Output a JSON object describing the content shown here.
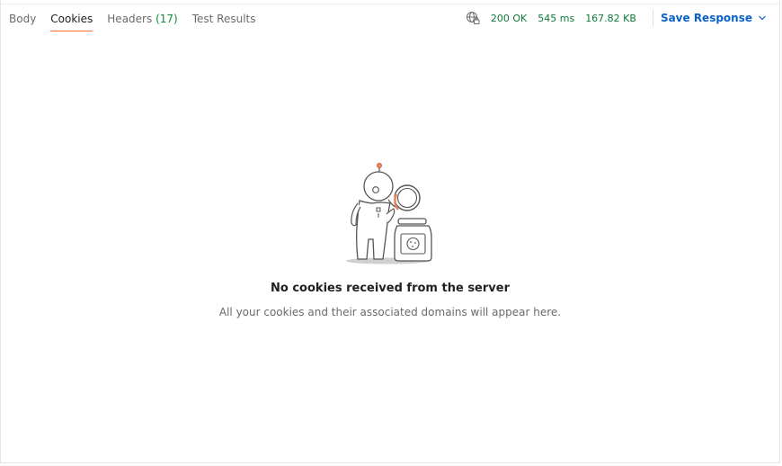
{
  "tabs": [
    {
      "label": "Body"
    },
    {
      "label": "Cookies",
      "active": true
    },
    {
      "label": "Headers",
      "count": "(17)"
    },
    {
      "label": "Test Results"
    }
  ],
  "status": {
    "network_icon": "globe-lock-icon",
    "code": "200 OK",
    "time": "545 ms",
    "size": "167.82 KB",
    "save_label": "Save Response",
    "save_chevron": "chevron-down-icon"
  },
  "colors": {
    "accent": "#ff6c37",
    "status_green": "#0f7a36",
    "link_blue": "#0b63c5"
  },
  "empty_state": {
    "illustration": "astronaut-cookie-jar-illustration",
    "title": "No cookies received from the server",
    "subtitle": "All your cookies and their associated domains will appear here."
  }
}
